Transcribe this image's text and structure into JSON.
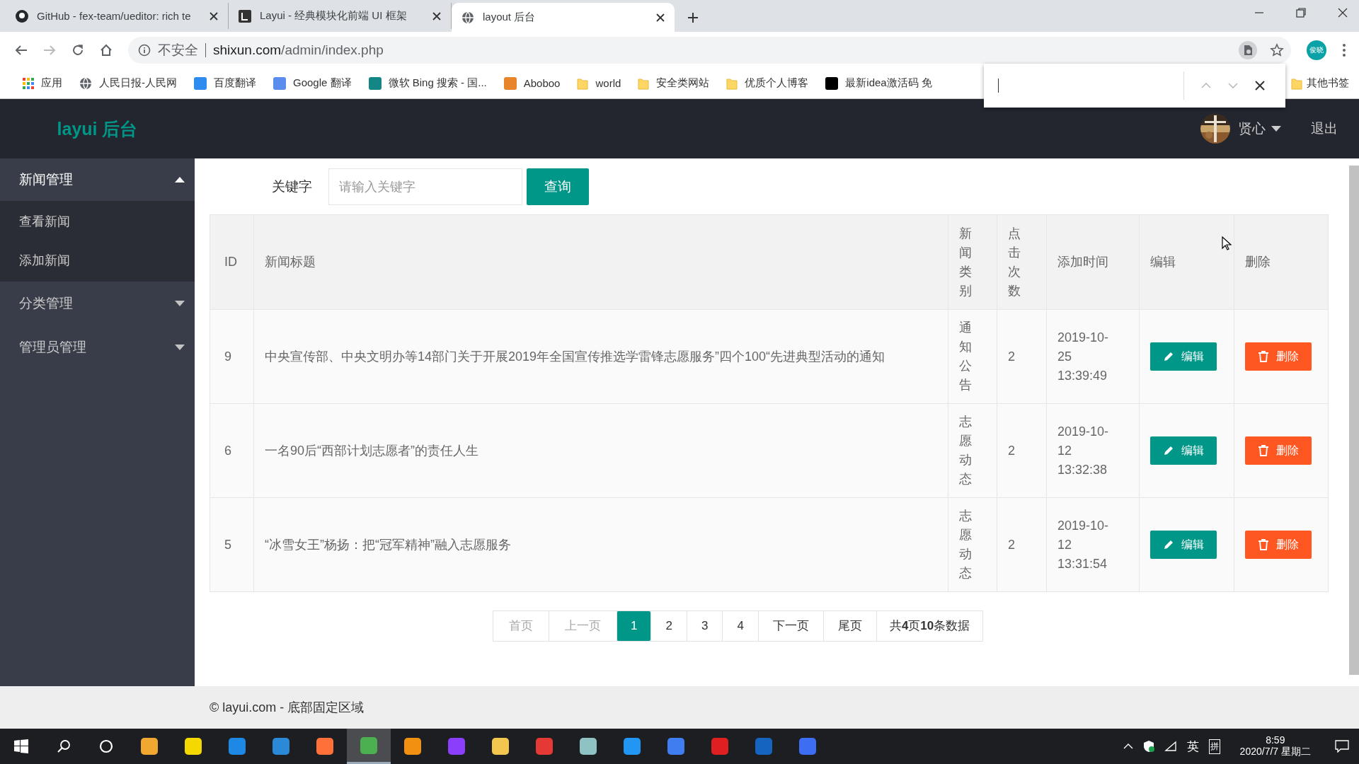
{
  "browser": {
    "tabs": [
      {
        "title": "GitHub - fex-team/ueditor: rich te",
        "kind": "github",
        "selected": false
      },
      {
        "title": "Layui - 经典模块化前端 UI 框架",
        "kind": "layui",
        "selected": false
      },
      {
        "title": "layout 后台",
        "kind": "globe",
        "selected": true
      }
    ],
    "address": {
      "security": "不安全",
      "host": "shixun.com",
      "path": "/admin/index.php"
    },
    "profile": "俊晓",
    "bookmarks": [
      {
        "label": "应用",
        "kind": "apps"
      },
      {
        "label": "人民日报-人民网",
        "kind": "globe"
      },
      {
        "label": "百度翻译",
        "kind": "badge",
        "color": "#2e8cf0"
      },
      {
        "label": "Google 翻译",
        "kind": "badge",
        "color": "#5b8def"
      },
      {
        "label": "微软 Bing 搜索 - 国...",
        "kind": "badge",
        "color": "#138686"
      },
      {
        "label": "Aboboo",
        "kind": "badge",
        "color": "#e8842a"
      },
      {
        "label": "world",
        "kind": "folder"
      },
      {
        "label": "安全类网站",
        "kind": "folder"
      },
      {
        "label": "优质个人博客",
        "kind": "folder"
      },
      {
        "label": "最新idea激活码 免",
        "kind": "badge",
        "color": "#000000"
      }
    ],
    "other_bookmarks": "其他书签"
  },
  "header": {
    "logo": "layui 后台",
    "user": "贤心",
    "logout": "退出"
  },
  "sidebar": {
    "items": [
      {
        "label": "新闻管理",
        "expanded": true,
        "children": [
          {
            "label": "查看新闻"
          },
          {
            "label": "添加新闻"
          }
        ]
      },
      {
        "label": "分类管理",
        "expanded": false
      },
      {
        "label": "管理员管理",
        "expanded": false
      }
    ]
  },
  "search": {
    "label": "关键字",
    "placeholder": "请输入关键字",
    "button": "查询"
  },
  "table": {
    "columns": [
      {
        "label": "ID",
        "kind": "text"
      },
      {
        "label": "新闻标题",
        "kind": "text"
      },
      {
        "label": "新闻类别",
        "kind": "vertical"
      },
      {
        "label": "点击次数",
        "kind": "vertical"
      },
      {
        "label": "添加时间",
        "kind": "text"
      },
      {
        "label": "编辑",
        "kind": "text"
      },
      {
        "label": "删除",
        "kind": "text"
      }
    ],
    "rows": [
      {
        "id": "9",
        "title": "中央宣传部、中央文明办等14部门关于开展2019年全国宣传推选学雷锋志愿服务”四个100“先进典型活动的通知",
        "category": "通知公告",
        "clicks": "2",
        "time": "2019-10-25 13:39:49",
        "edit": "编辑",
        "delete": "删除"
      },
      {
        "id": "6",
        "title": "一名90后“西部计划志愿者”的责任人生",
        "category": "志愿动态",
        "clicks": "2",
        "time": "2019-10-12 13:32:38",
        "edit": "编辑",
        "delete": "删除"
      },
      {
        "id": "5",
        "title": "“冰雪女王”杨扬：把“冠军精神”融入志愿服务",
        "category": "志愿动态",
        "clicks": "2",
        "time": "2019-10-12 13:31:54",
        "edit": "编辑",
        "delete": "删除"
      }
    ]
  },
  "pagination": {
    "items": [
      {
        "label": "首页",
        "disabled": true,
        "selected": false
      },
      {
        "label": "上一页",
        "disabled": true,
        "selected": false
      },
      {
        "label": "1",
        "disabled": false,
        "selected": true
      },
      {
        "label": "2",
        "disabled": false,
        "selected": false
      },
      {
        "label": "3",
        "disabled": false,
        "selected": false
      },
      {
        "label": "4",
        "disabled": false,
        "selected": false
      },
      {
        "label": "下一页",
        "disabled": false,
        "selected": false
      },
      {
        "label": "尾页",
        "disabled": false,
        "selected": false
      }
    ],
    "summary": "共**4**页**10**条数据"
  },
  "footer": "© layui.com - 底部固定区域",
  "taskbar": {
    "apps": [
      {
        "color": "#f0a830",
        "active": false
      },
      {
        "color": "#f5d800",
        "active": false
      },
      {
        "color": "#1e88e5",
        "active": false
      },
      {
        "color": "#2b8ad8",
        "active": false
      },
      {
        "color": "#ff7139",
        "active": false
      },
      {
        "color": "#4caf50",
        "active": true
      },
      {
        "color": "#f29111",
        "active": false
      },
      {
        "color": "#8a3ffc",
        "active": false
      },
      {
        "color": "#f3c74f",
        "active": false
      },
      {
        "color": "#e53935",
        "active": false
      },
      {
        "color": "#8fc3c3",
        "active": false
      },
      {
        "color": "#2196f3",
        "active": false
      },
      {
        "color": "#3f7ef0",
        "active": false
      },
      {
        "color": "#e02020",
        "active": false
      },
      {
        "color": "#1565c0",
        "active": false
      },
      {
        "color": "#3d6df2",
        "active": false
      }
    ],
    "tray": [
      "英",
      "拼"
    ],
    "time": "8:59",
    "date": "2020/7/7 星期二"
  }
}
